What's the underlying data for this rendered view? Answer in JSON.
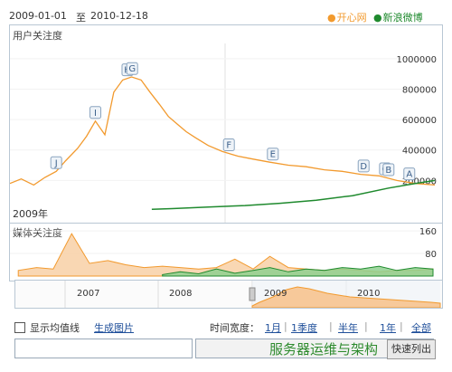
{
  "header": {
    "start_date": "2009-01-01",
    "separator": "至",
    "end_date": "2010-12-18",
    "legend": [
      {
        "label": "开心网",
        "color": "#f29a2e"
      },
      {
        "label": "新浪微博",
        "color": "#1f8a2e"
      }
    ]
  },
  "top_panel": {
    "label": "用户关注度",
    "corner_label": "2009年",
    "yticks": [
      "1000000",
      "800000",
      "600000",
      "400000",
      "200000"
    ]
  },
  "bottom_panel": {
    "label": "媒体关注度",
    "yticks": [
      "160",
      "80"
    ]
  },
  "navigator": {
    "years": [
      "2007",
      "2008",
      "2009",
      "2010"
    ]
  },
  "controls": {
    "checkbox_label": "显示均值线",
    "generate_link": "生成图片",
    "time_width_label": "时间宽度：",
    "options": [
      "1月",
      "1季度",
      "半年",
      "1年",
      "全部"
    ]
  },
  "bottom_bar": {
    "button_label": "快速列出",
    "watermark": "服务器运维与架构"
  },
  "chart_data": [
    {
      "type": "line",
      "title": "用户关注度",
      "ylim": [
        0,
        1100000
      ],
      "xrange": [
        "2009-01-01",
        "2010-12-18"
      ],
      "series": [
        {
          "name": "开心网",
          "color": "#f29a2e",
          "x": [
            "2009-01-01",
            "2009-01-20",
            "2009-02-10",
            "2009-03-01",
            "2009-03-20",
            "2009-04-05",
            "2009-04-25",
            "2009-05-10",
            "2009-05-25",
            "2009-06-10",
            "2009-06-25",
            "2009-07-10",
            "2009-07-25",
            "2009-08-10",
            "2009-08-25",
            "2009-09-10",
            "2009-09-25",
            "2009-10-10",
            "2009-10-25",
            "2009-11-10",
            "2009-12-01",
            "2009-12-25",
            "2010-01-20",
            "2010-02-15",
            "2010-03-15",
            "2010-04-15",
            "2010-05-15",
            "2010-06-15",
            "2010-07-15",
            "2010-08-15",
            "2010-09-15",
            "2010-10-15",
            "2010-11-15",
            "2010-12-18"
          ],
          "values": [
            180000,
            210000,
            170000,
            220000,
            260000,
            330000,
            410000,
            490000,
            590000,
            500000,
            780000,
            860000,
            880000,
            860000,
            780000,
            700000,
            620000,
            570000,
            520000,
            480000,
            430000,
            390000,
            360000,
            340000,
            320000,
            300000,
            290000,
            270000,
            260000,
            240000,
            230000,
            200000,
            180000,
            170000
          ]
        },
        {
          "name": "新浪微博",
          "color": "#1f8a2e",
          "x": [
            "2009-08-28",
            "2009-10-01",
            "2009-12-01",
            "2010-02-01",
            "2010-04-01",
            "2010-06-01",
            "2010-08-01",
            "2010-10-01",
            "2010-11-15",
            "2010-12-18"
          ],
          "values": [
            10000,
            15000,
            25000,
            35000,
            50000,
            70000,
            100000,
            150000,
            180000,
            200000
          ]
        }
      ],
      "event_markers": [
        "J",
        "I",
        "H",
        "G",
        "F",
        "E",
        "D",
        "C",
        "B",
        "A"
      ]
    },
    {
      "type": "area",
      "title": "媒体关注度",
      "ylim": [
        0,
        170
      ],
      "series": [
        {
          "name": "开心网",
          "color": "#f29a2e",
          "x": [
            "2009-01",
            "2009-02",
            "2009-03",
            "2009-04",
            "2009-05",
            "2009-06",
            "2009-07",
            "2009-08",
            "2009-09",
            "2009-10",
            "2009-11",
            "2009-12",
            "2010-01",
            "2010-02",
            "2010-03",
            "2010-04",
            "2010-05",
            "2010-06",
            "2010-07",
            "2010-08",
            "2010-09",
            "2010-10",
            "2010-11",
            "2010-12"
          ],
          "values": [
            20,
            30,
            25,
            150,
            45,
            55,
            40,
            30,
            35,
            30,
            25,
            30,
            60,
            25,
            70,
            30,
            25,
            20,
            25,
            20,
            15,
            20,
            20,
            25
          ]
        },
        {
          "name": "新浪微博",
          "color": "#1f8a2e",
          "x": [
            "2009-09",
            "2009-10",
            "2009-11",
            "2009-12",
            "2010-01",
            "2010-02",
            "2010-03",
            "2010-04",
            "2010-05",
            "2010-06",
            "2010-07",
            "2010-08",
            "2010-09",
            "2010-10",
            "2010-11",
            "2010-12"
          ],
          "values": [
            5,
            15,
            8,
            25,
            10,
            20,
            30,
            15,
            25,
            20,
            30,
            25,
            35,
            20,
            30,
            25
          ]
        }
      ]
    }
  ]
}
